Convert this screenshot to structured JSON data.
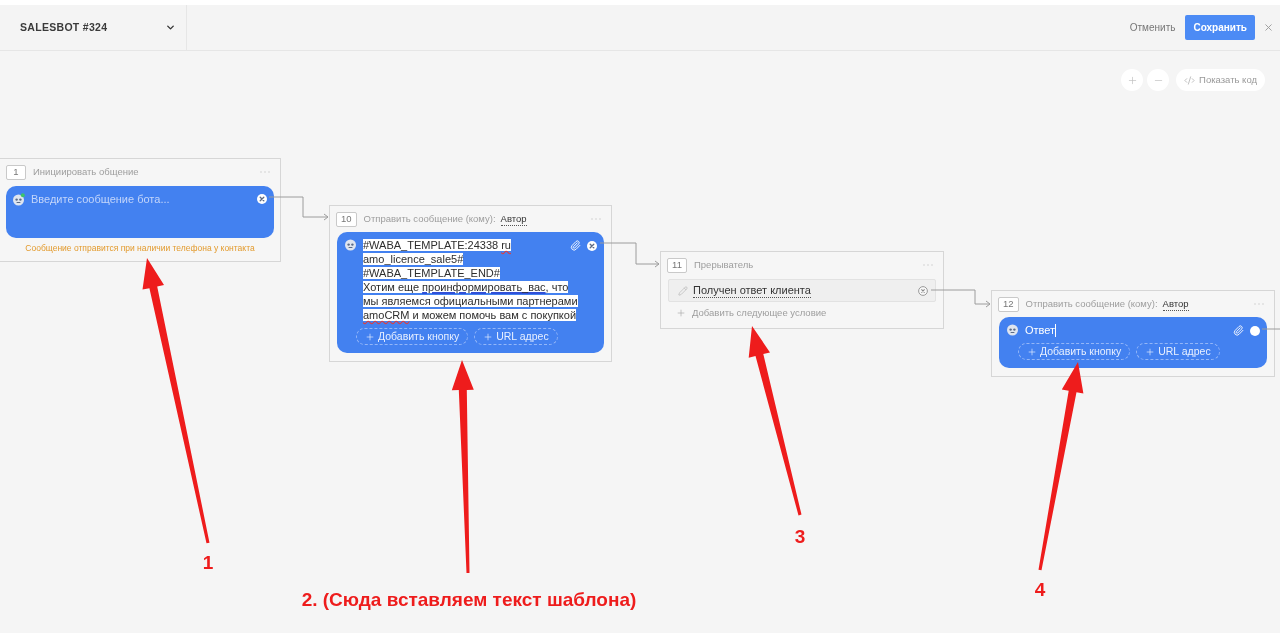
{
  "header": {
    "title": "SALESBOT #324",
    "cancel": "Отменить",
    "save": "Сохранить"
  },
  "canvas_toolbar": {
    "show_code": "Показать код"
  },
  "nodes": [
    {
      "kind": "start",
      "number": "1",
      "title": "Инициировать общение",
      "message": {
        "placeholder": "Введите сообщение бота..."
      },
      "note": "Сообщение отправится при наличии телефона у контакта"
    },
    {
      "kind": "send",
      "number": "10",
      "title": "Отправить сообщение (кому):",
      "recipient": "Автор",
      "message": {
        "selected": true,
        "focused": false,
        "lines": [
          [
            {
              "kind": "plain",
              "text": "#WABA_TEMPLATE:24338 "
            },
            {
              "kind": "misspelled",
              "text": "ru"
            }
          ],
          [
            {
              "kind": "plain",
              "text": "amo_licence_sale5#"
            }
          ],
          [
            {
              "kind": "plain",
              "text": "#WABA_TEMPLATE_END#"
            }
          ],
          [
            {
              "kind": "plain",
              "text": "Хотим еще "
            },
            {
              "kind": "questionable",
              "text": "проинформировать_вас"
            },
            {
              "kind": "plain",
              "text": ", что"
            }
          ],
          [
            {
              "kind": "plain",
              "text": "мы являемся официальными партнерами"
            }
          ],
          [
            {
              "kind": "misspelled",
              "text": "amoCRM"
            },
            {
              "kind": "plain",
              "text": " и можем помочь вам с покупкой"
            }
          ]
        ]
      },
      "buttons": [
        "Добавить кнопку",
        "URL адрес"
      ]
    },
    {
      "kind": "breaker",
      "number": "11",
      "title": "Прерыватель",
      "conditions": [
        {
          "text": "Получен ответ клиента"
        }
      ],
      "add_condition": "Добавить следующее условие"
    },
    {
      "kind": "send",
      "number": "12",
      "title": "Отправить сообщение (кому):",
      "recipient": "Автор",
      "message": {
        "selected": false,
        "focused": true,
        "lines": [
          [
            {
              "kind": "plain",
              "text": "Ответ"
            }
          ]
        ]
      },
      "buttons": [
        "Добавить кнопку",
        "URL адрес"
      ]
    }
  ],
  "annotations": [
    {
      "label": "1"
    },
    {
      "label": "2. (Сюда вставляем текст шаблона)"
    },
    {
      "label": "3"
    },
    {
      "label": "4"
    }
  ]
}
